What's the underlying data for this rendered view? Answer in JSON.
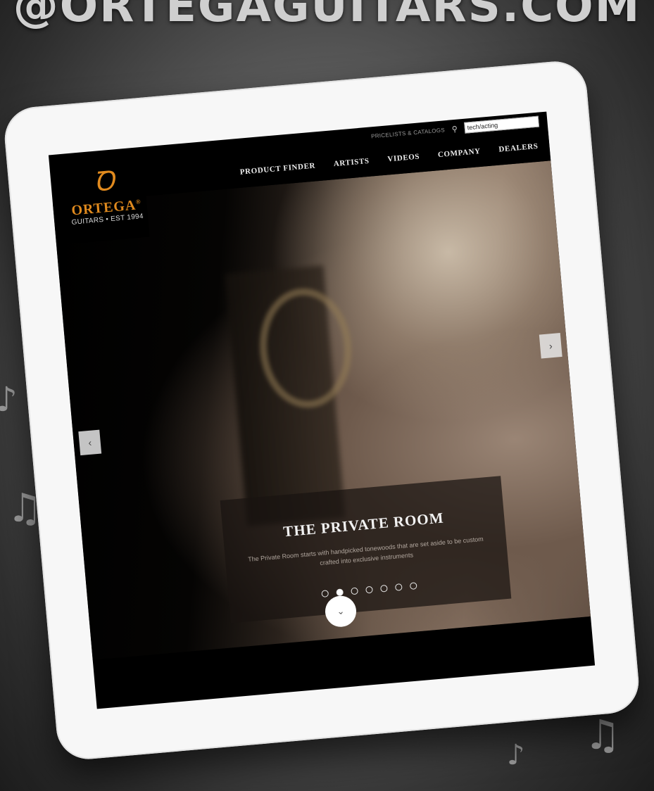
{
  "banner": {
    "text": "@ORTEGAGUITARS.COM"
  },
  "site": {
    "logo": {
      "glyph": "Ꝺ",
      "name": "ORTEGA",
      "reg": "®",
      "tagline": "GUITARS • EST 1994"
    },
    "utility_nav": {
      "link": "PRICELISTS & CATALOGS",
      "search_value": "tech/acting"
    },
    "main_nav": [
      "PRODUCT FINDER",
      "ARTISTS",
      "VIDEOS",
      "COMPANY",
      "DEALERS"
    ],
    "slider": {
      "title": "THE PRIVATE ROOM",
      "text": "The Private Room starts with handpicked tonewoods that are set aside to be custom crafted into exclusive instruments",
      "dot_count": 7,
      "active_dot": 2,
      "prev_glyph": "‹",
      "next_glyph": "›",
      "scroll_glyph": "⌄"
    }
  },
  "icons": {
    "search": "search-icon",
    "prev": "chevron-left-icon",
    "next": "chevron-right-icon",
    "scroll": "chevron-down-icon"
  },
  "colors": {
    "brand": "#e08a1e",
    "tablet": "#f7f7f7"
  }
}
